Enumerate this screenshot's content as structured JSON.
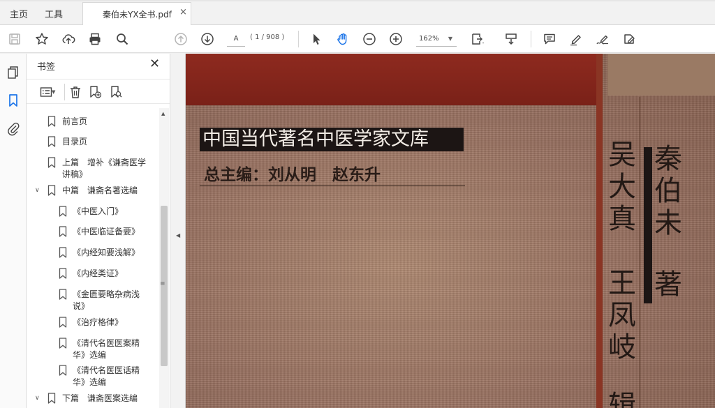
{
  "tabs": {
    "home": "主页",
    "tools": "工具",
    "document_title": "秦伯未YX全书.pdf",
    "close": "×"
  },
  "toolbar": {
    "page_input": "A",
    "page_count": "( 1 / 908 )",
    "zoom_value": "162%",
    "zoom_caret": "▼"
  },
  "bookmarks_panel": {
    "title": "书签",
    "close": "✕",
    "items": [
      {
        "label": "前言页",
        "level": 0,
        "twisty": ""
      },
      {
        "label": "目录页",
        "level": 0,
        "twisty": ""
      },
      {
        "label": "上篇　增补《谦斋医学讲稿》",
        "level": 0,
        "twisty": ""
      },
      {
        "label": "中篇　谦斋名著选编",
        "level": 0,
        "twisty": "∨"
      },
      {
        "label": "《中医入门》",
        "level": 1,
        "twisty": ""
      },
      {
        "label": "《中医临证备要》",
        "level": 1,
        "twisty": ""
      },
      {
        "label": "《内经知要浅解》",
        "level": 1,
        "twisty": ""
      },
      {
        "label": "《内经类证》",
        "level": 1,
        "twisty": ""
      },
      {
        "label": "《金匮要略杂病浅说》",
        "level": 1,
        "twisty": ""
      },
      {
        "label": "《治疗格律》",
        "level": 1,
        "twisty": ""
      },
      {
        "label": "《清代名医医案精华》选编",
        "level": 1,
        "twisty": ""
      },
      {
        "label": "《清代名医医话精华》选编",
        "level": 1,
        "twisty": ""
      },
      {
        "label": "下篇　谦斋医案选编",
        "level": 0,
        "twisty": "∨"
      }
    ]
  },
  "document": {
    "series_title": "中国当代著名中医学家文库",
    "chief_editors": "总主编：刘从明　赵东升",
    "author_col1": "秦伯未",
    "author_role": "著",
    "author_col2": "吴大真",
    "author_col3": "王凤岐",
    "author_col3_tail": "辑"
  },
  "colors": {
    "accent_blue": "#1a73e8",
    "cover_red": "#8e2a1f",
    "cover_cloth": "#987060"
  }
}
